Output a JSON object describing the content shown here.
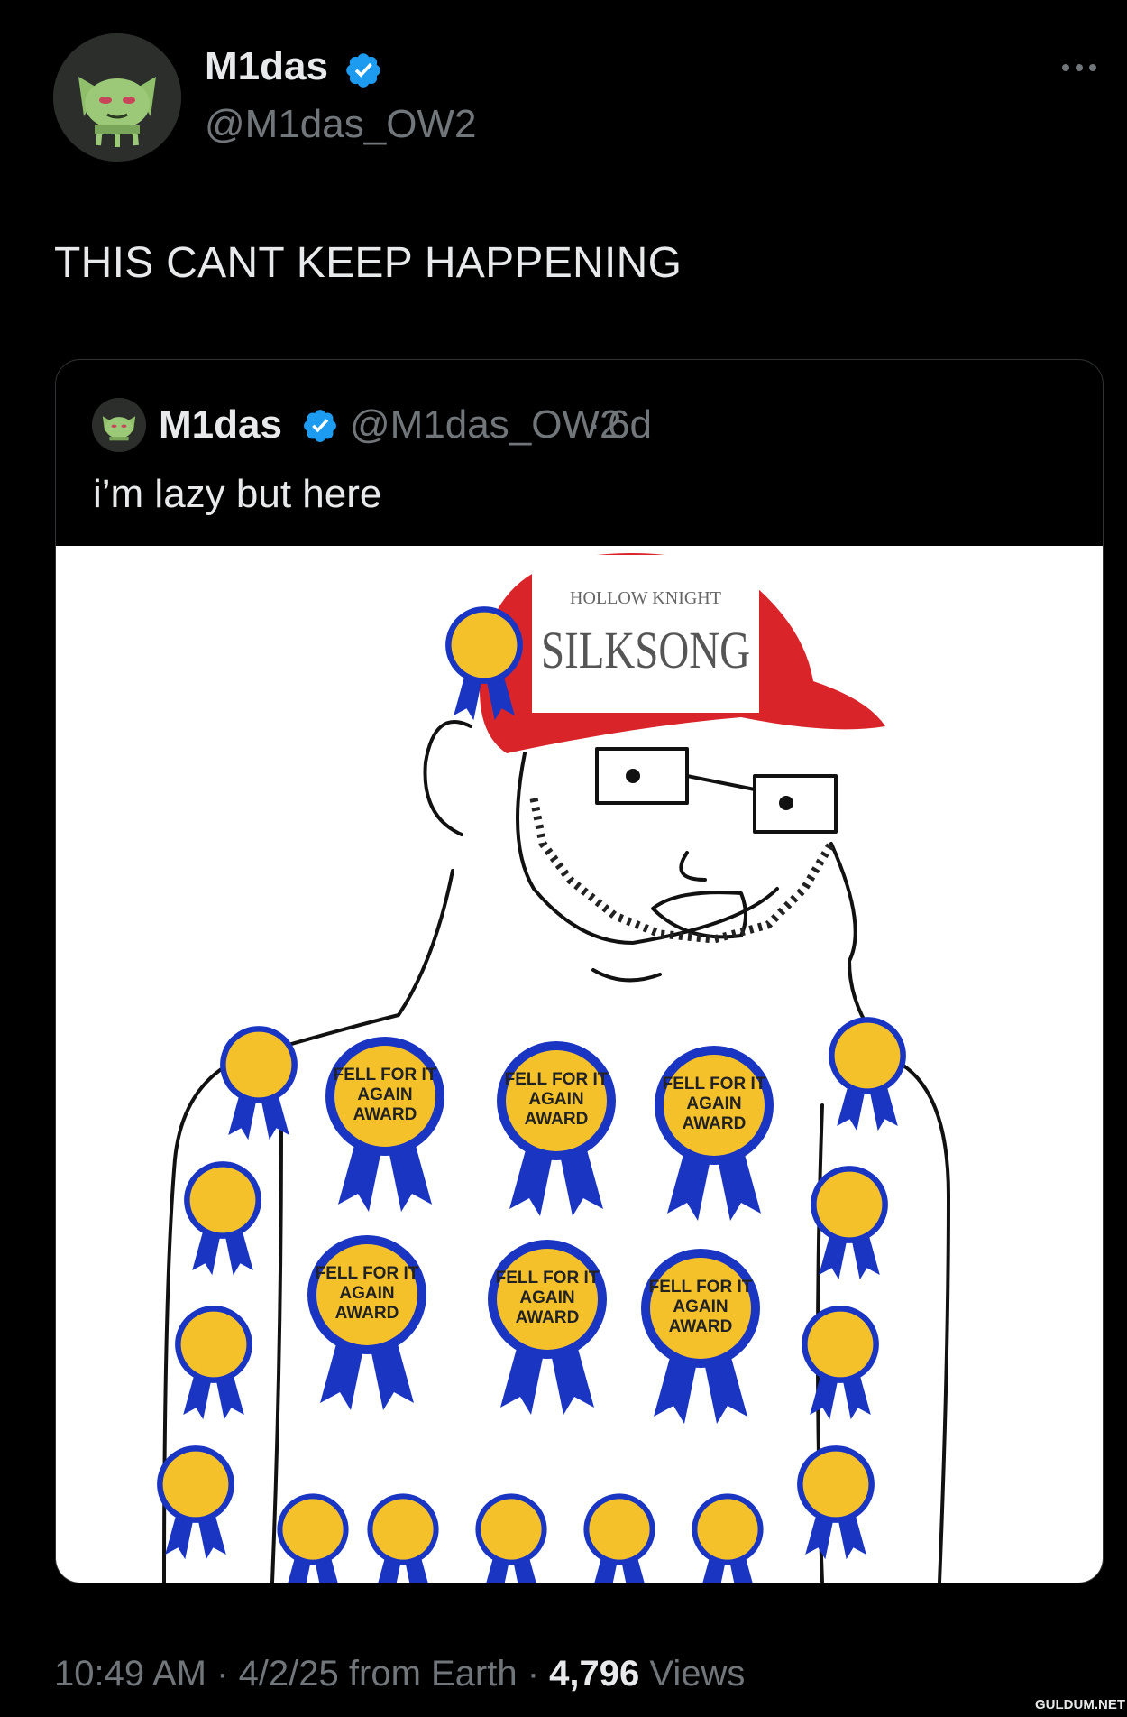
{
  "author": {
    "name": "M1das",
    "handle": "@M1das_OW2"
  },
  "tweet": {
    "text": "THIS CANT KEEP HAPPENING"
  },
  "quoted": {
    "name": "M1das",
    "handle": "@M1das_OW2",
    "separator": "·",
    "time": "6d",
    "text": "i’m lazy but here",
    "image": {
      "hat_logo_top": "HOLLOW KNIGHT",
      "hat_logo_main": "SILKSONG",
      "ribbon_line1": "FELL FOR IT",
      "ribbon_line2": "AGAIN",
      "ribbon_line3": "AWARD"
    }
  },
  "footer": {
    "time": "10:49 AM",
    "sep1": " · ",
    "date": "4/2/25",
    "source": " from Earth",
    "sep2": " · ",
    "views_count": "4,796",
    "views_label": " Views"
  },
  "watermark": "GULDUM.NET",
  "colors": {
    "background": "#000000",
    "text_primary": "#e7e9ea",
    "text_secondary": "#71767b",
    "verified_blue": "#1d9bf0",
    "card_border": "#2f3336",
    "ribbon_gold": "#f5c12b",
    "ribbon_blue": "#1a35c2",
    "hat_red": "#d9252a"
  },
  "icons": {
    "verified": "verified-badge-icon",
    "more": "more-options-icon"
  }
}
